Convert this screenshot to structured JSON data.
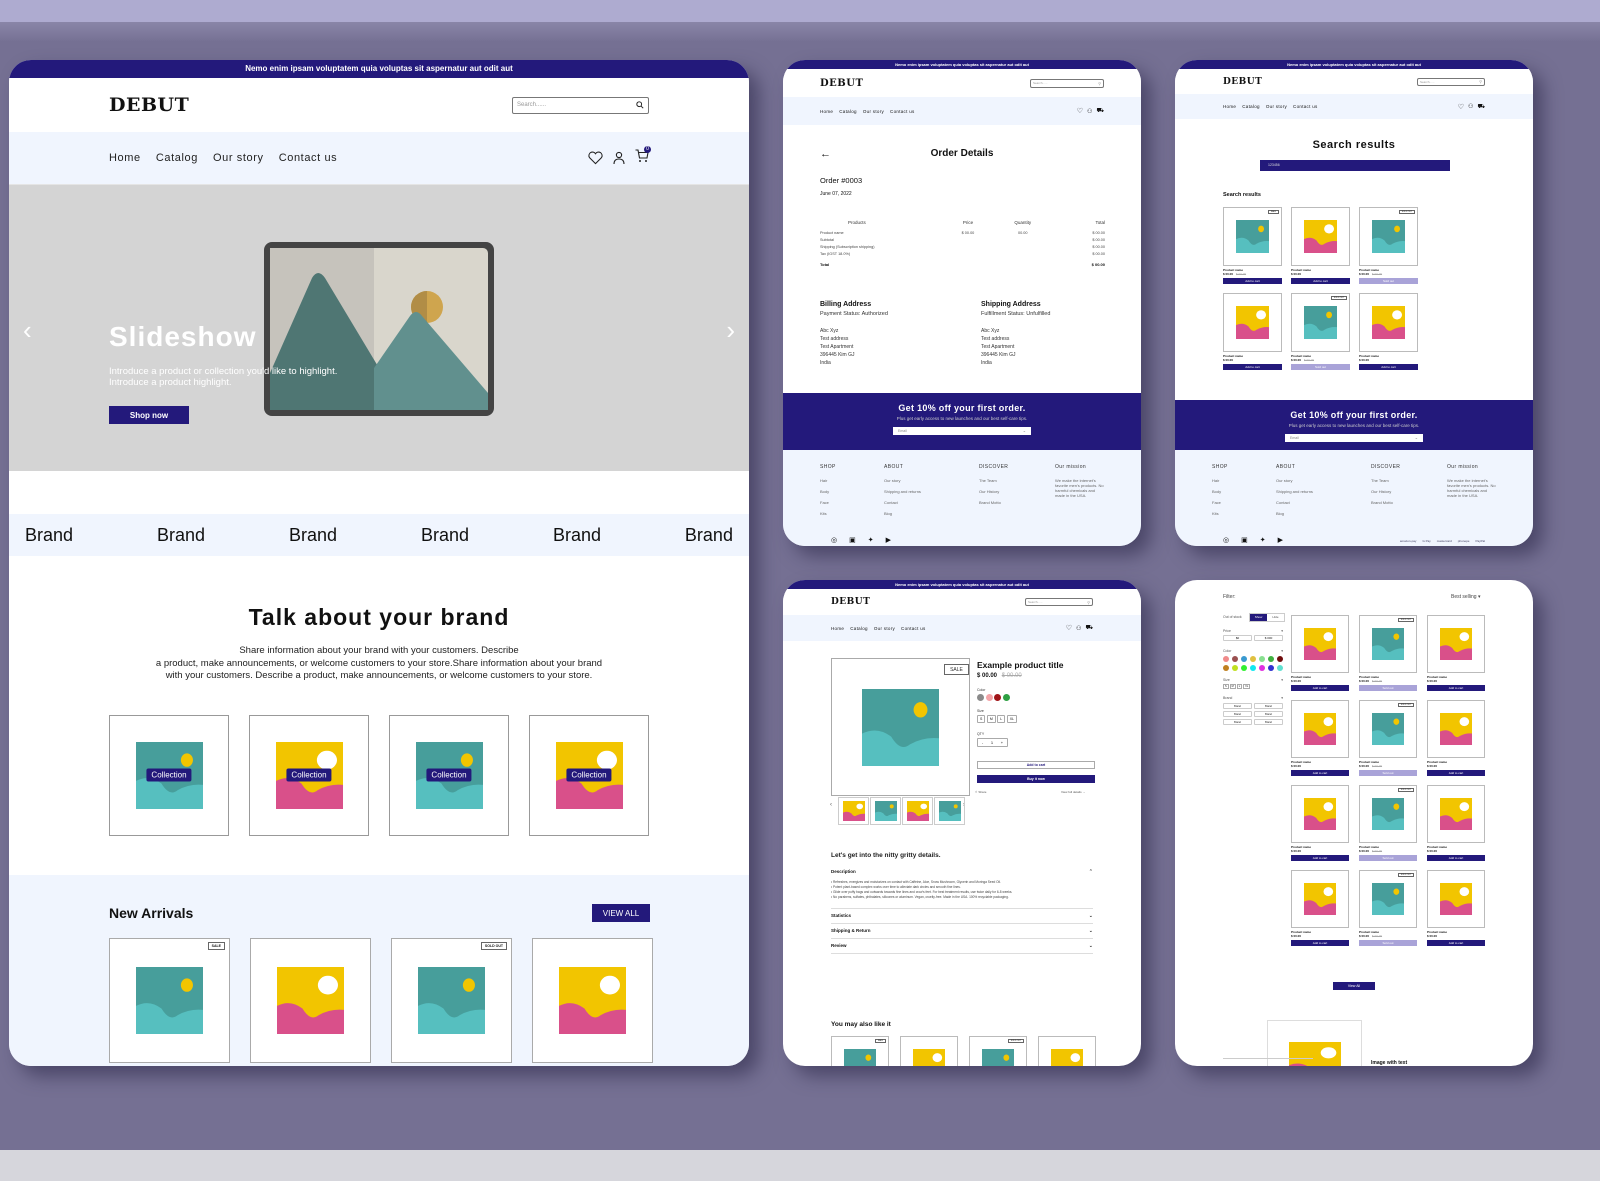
{
  "colors": {
    "brand": "#23197b",
    "nav_bg": "#f0f5fe",
    "teal": "#479e9b",
    "teal_light": "#56bfbf",
    "yellow": "#f2c500",
    "pink": "#d9508a",
    "backdrop": "#757093",
    "sold_out": "#a9a3d8"
  },
  "store": {
    "announcement": "Nemo enim ipsam voluptatem quia voluptas sit aspernatur aut odit aut",
    "logo": "DEBUT",
    "search_placeholder": "Search......",
    "nav": [
      "Home",
      "Catalog",
      "Our story",
      "Contact us"
    ],
    "cart_count": "0",
    "icons": [
      "heart-icon",
      "user-icon",
      "cart-icon",
      "search-icon"
    ]
  },
  "home": {
    "slideshow": {
      "title": "Slideshow",
      "text_line1": "Introduce a product or collection you'd like to highlight.",
      "text_line2": "Introduce a product highlight.",
      "cta": "Shop now"
    },
    "brands": [
      "Brand",
      "Brand",
      "Brand",
      "Brand",
      "Brand",
      "Brand"
    ],
    "about": {
      "title": "Talk about your brand",
      "text": [
        "Share information about your brand with your customers. Describe",
        "a product, make announcements, or welcome customers to your store.Share information about your brand",
        "with your customers. Describe a product, make announcements, or welcome customers to your store."
      ]
    },
    "collections": [
      {
        "label": "Collection",
        "style": "teal"
      },
      {
        "label": "Collection",
        "style": "yellow"
      },
      {
        "label": "Collection",
        "style": "teal"
      },
      {
        "label": "Collection",
        "style": "yellow"
      }
    ],
    "new_arrivals": {
      "title": "New Arrivals",
      "view_all": "VIEW ALL",
      "items": [
        {
          "style": "teal",
          "badge": "SALE"
        },
        {
          "style": "yellow",
          "badge": ""
        },
        {
          "style": "teal",
          "badge": "SOLD OUT"
        },
        {
          "style": "yellow",
          "badge": ""
        }
      ]
    }
  },
  "order": {
    "back": "←",
    "title": "Order Details",
    "order_no": "Order #0003",
    "date": "June 07, 2022",
    "headers": [
      "Products",
      "Price",
      "Quantity",
      "Total"
    ],
    "rows": [
      [
        "Product name",
        "$ 00.00",
        "00.00",
        "$ 00.00"
      ],
      [
        "Subtotal",
        "",
        "",
        "$ 00.00"
      ],
      [
        "Shipping (Subscription shipping)",
        "",
        "",
        "$ 00.00"
      ],
      [
        "Tax (IGST 18.0%)",
        "",
        "",
        "$ 00.00"
      ]
    ],
    "total": [
      "Total",
      "$ 00.00"
    ],
    "billing": {
      "title": "Billing Address",
      "status": "Payment Status: Authorized",
      "lines": [
        "Abc Xyz",
        "Test address",
        "Test Apartment",
        "396445 Kim GJ",
        "India"
      ]
    },
    "shipping": {
      "title": "Shipping Address",
      "status": "Fulfillment Status: Unfulfilled",
      "lines": [
        "Abc Xyz",
        "Test address",
        "Test Apartment",
        "396445 Kim GJ",
        "India"
      ]
    }
  },
  "newsletter": {
    "title": "Get 10% off your first order.",
    "subtitle": "Plus get early access to new launches and our best self-care tips.",
    "email_placeholder": "Email",
    "submit": "→"
  },
  "footer": {
    "columns": [
      {
        "title": "SHOP",
        "links": [
          "Hair",
          "Body",
          "Face",
          "Kits"
        ]
      },
      {
        "title": "ABOUT",
        "links": [
          "Our story",
          "Shipping and returns",
          "Contact",
          "Blog"
        ]
      },
      {
        "title": "DISCOVER",
        "links": [
          "The Team",
          "Our History",
          "Brand Motto"
        ]
      },
      {
        "title": "Our mission",
        "links": [
          "We make the internet's favorite men's products. No harmful chemicals and made in the USA."
        ]
      }
    ],
    "social": [
      "instagram-icon",
      "facebook-icon",
      "twitter-icon",
      "youtube-icon"
    ],
    "payments": [
      "amazon-pay",
      "G Pay",
      "mastercard",
      "phonepe",
      "PayPal"
    ]
  },
  "search": {
    "title": "Search results",
    "query": "123456",
    "results_label": "Search results",
    "items": [
      {
        "style": "teal",
        "badge": "SALE",
        "name": "Product name",
        "price": "$ 00.00",
        "compare": "$ 00.00",
        "button": "Add to cart",
        "sold_out": false
      },
      {
        "style": "yellow",
        "badge": "",
        "name": "Product name",
        "price": "$ 00.00",
        "compare": "",
        "button": "Add to cart",
        "sold_out": false
      },
      {
        "style": "teal",
        "badge": "SOLD OUT",
        "name": "Product name",
        "price": "$ 00.00",
        "compare": "$ 00.00",
        "button": "Sold out",
        "sold_out": true
      },
      {
        "style": "yellow",
        "badge": "",
        "name": "Product name",
        "price": "$ 00.00",
        "compare": "",
        "button": "Add to cart",
        "sold_out": false
      },
      {
        "style": "teal",
        "badge": "SOLD OUT",
        "name": "Product name",
        "price": "$ 00.00",
        "compare": "$ 00.00",
        "button": "Sold out",
        "sold_out": true
      },
      {
        "style": "yellow",
        "badge": "",
        "name": "Product name",
        "price": "$ 00.00",
        "compare": "",
        "button": "Add to cart",
        "sold_out": false
      }
    ]
  },
  "product": {
    "badge": "SALE",
    "title": "Example product title",
    "price": "$ 00.00",
    "compare": "$ 00.00",
    "color_label": "Color",
    "colors": [
      "#8a8a8a",
      "#f4a4a8",
      "#a01418",
      "#2ea043"
    ],
    "size_label": "Size",
    "sizes": [
      "S",
      "M",
      "L",
      "XL"
    ],
    "qty_label": "QTY",
    "qty": "1",
    "minus": "-",
    "plus": "+",
    "add_to_cart": "Add to cart",
    "buy_now": "Buy it now",
    "share": "Share",
    "view_details": "View full details →",
    "thumbs": [
      "yellow",
      "teal",
      "yellow",
      "teal"
    ],
    "details_title": "Let's get into the nitty gritty details.",
    "accordions": [
      {
        "label": "Description",
        "open": true
      },
      {
        "label": "Statistics",
        "open": false
      },
      {
        "label": "Shipping & Return",
        "open": false
      },
      {
        "label": "Review",
        "open": false
      }
    ],
    "description": [
      "• Refreshes, energizes and moisturizes on contact with Caffeine, Aloe, Snow Mushroom, Glycerin and Moringa Seed Oil.",
      "• Potent plant-based complex works over time to alleviate dark circles and smooth fine lines.",
      "• Glide over puffy bags and outwards towards fine lines and crow's feet. For best treatment results, use twice daily for 6-8 weeks.",
      "• No parabens, sulfates, phthalates, silicones or aluminum. Vegan, cruelty-free. Made in the USA. 100% recyclable packaging."
    ],
    "related_title": "You may also like it",
    "related": [
      {
        "style": "teal",
        "badge": "SALE"
      },
      {
        "style": "yellow",
        "badge": ""
      },
      {
        "style": "teal",
        "badge": "SOLD OUT"
      },
      {
        "style": "yellow",
        "badge": ""
      }
    ]
  },
  "catalog": {
    "filter_label": "Filter:",
    "sort": "Best selling",
    "stock_label": "Out of stock",
    "stock_options": [
      "Show",
      "Hide"
    ],
    "price_label": "Price",
    "price_min": "$0",
    "price_max": "$ 000",
    "color_label": "Color",
    "colors": [
      "#f08a8a",
      "#9a5050",
      "#3a9ad0",
      "#e0c040",
      "#88e090",
      "#40b040",
      "#700c0c",
      "#c08020",
      "#c0e020",
      "#30f030",
      "#10e8f0",
      "#e030e0",
      "#3030d0",
      "#60e0d0"
    ],
    "size_label": "Size",
    "sizes": [
      "S",
      "M",
      "L",
      "XL"
    ],
    "brand_label": "Brand",
    "brands": [
      "Brand",
      "Brand",
      "Brand",
      "Brand",
      "Brand",
      "Brand"
    ],
    "grid": [
      "yellow",
      "teal",
      "yellow",
      "yellow",
      "teal",
      "yellow",
      "yellow",
      "teal",
      "yellow",
      "yellow",
      "teal",
      "yellow"
    ],
    "item_name": "Product name",
    "item_price": "$ 00.00",
    "item_compare": "$ 00.00",
    "add": "Add to cart",
    "sold": "Sold out",
    "sold_badge": "SOLD OUT",
    "view_all": "View All",
    "image_with_text": "Image with text"
  }
}
